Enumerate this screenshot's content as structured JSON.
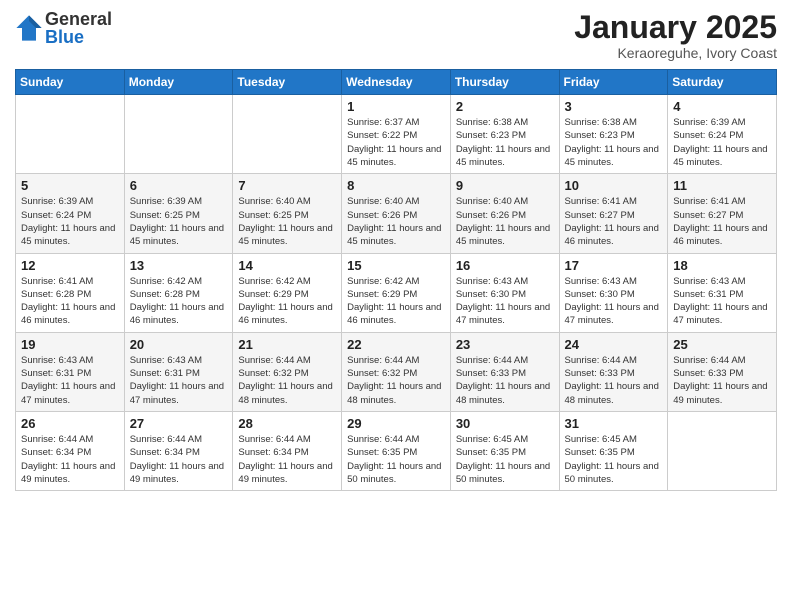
{
  "logo": {
    "general": "General",
    "blue": "Blue"
  },
  "title": "January 2025",
  "subtitle": "Keraoreguhe, Ivory Coast",
  "weekdays": [
    "Sunday",
    "Monday",
    "Tuesday",
    "Wednesday",
    "Thursday",
    "Friday",
    "Saturday"
  ],
  "weeks": [
    [
      {
        "day": "",
        "info": ""
      },
      {
        "day": "",
        "info": ""
      },
      {
        "day": "",
        "info": ""
      },
      {
        "day": "1",
        "info": "Sunrise: 6:37 AM\nSunset: 6:22 PM\nDaylight: 11 hours and 45 minutes."
      },
      {
        "day": "2",
        "info": "Sunrise: 6:38 AM\nSunset: 6:23 PM\nDaylight: 11 hours and 45 minutes."
      },
      {
        "day": "3",
        "info": "Sunrise: 6:38 AM\nSunset: 6:23 PM\nDaylight: 11 hours and 45 minutes."
      },
      {
        "day": "4",
        "info": "Sunrise: 6:39 AM\nSunset: 6:24 PM\nDaylight: 11 hours and 45 minutes."
      }
    ],
    [
      {
        "day": "5",
        "info": "Sunrise: 6:39 AM\nSunset: 6:24 PM\nDaylight: 11 hours and 45 minutes."
      },
      {
        "day": "6",
        "info": "Sunrise: 6:39 AM\nSunset: 6:25 PM\nDaylight: 11 hours and 45 minutes."
      },
      {
        "day": "7",
        "info": "Sunrise: 6:40 AM\nSunset: 6:25 PM\nDaylight: 11 hours and 45 minutes."
      },
      {
        "day": "8",
        "info": "Sunrise: 6:40 AM\nSunset: 6:26 PM\nDaylight: 11 hours and 45 minutes."
      },
      {
        "day": "9",
        "info": "Sunrise: 6:40 AM\nSunset: 6:26 PM\nDaylight: 11 hours and 45 minutes."
      },
      {
        "day": "10",
        "info": "Sunrise: 6:41 AM\nSunset: 6:27 PM\nDaylight: 11 hours and 46 minutes."
      },
      {
        "day": "11",
        "info": "Sunrise: 6:41 AM\nSunset: 6:27 PM\nDaylight: 11 hours and 46 minutes."
      }
    ],
    [
      {
        "day": "12",
        "info": "Sunrise: 6:41 AM\nSunset: 6:28 PM\nDaylight: 11 hours and 46 minutes."
      },
      {
        "day": "13",
        "info": "Sunrise: 6:42 AM\nSunset: 6:28 PM\nDaylight: 11 hours and 46 minutes."
      },
      {
        "day": "14",
        "info": "Sunrise: 6:42 AM\nSunset: 6:29 PM\nDaylight: 11 hours and 46 minutes."
      },
      {
        "day": "15",
        "info": "Sunrise: 6:42 AM\nSunset: 6:29 PM\nDaylight: 11 hours and 46 minutes."
      },
      {
        "day": "16",
        "info": "Sunrise: 6:43 AM\nSunset: 6:30 PM\nDaylight: 11 hours and 47 minutes."
      },
      {
        "day": "17",
        "info": "Sunrise: 6:43 AM\nSunset: 6:30 PM\nDaylight: 11 hours and 47 minutes."
      },
      {
        "day": "18",
        "info": "Sunrise: 6:43 AM\nSunset: 6:31 PM\nDaylight: 11 hours and 47 minutes."
      }
    ],
    [
      {
        "day": "19",
        "info": "Sunrise: 6:43 AM\nSunset: 6:31 PM\nDaylight: 11 hours and 47 minutes."
      },
      {
        "day": "20",
        "info": "Sunrise: 6:43 AM\nSunset: 6:31 PM\nDaylight: 11 hours and 47 minutes."
      },
      {
        "day": "21",
        "info": "Sunrise: 6:44 AM\nSunset: 6:32 PM\nDaylight: 11 hours and 48 minutes."
      },
      {
        "day": "22",
        "info": "Sunrise: 6:44 AM\nSunset: 6:32 PM\nDaylight: 11 hours and 48 minutes."
      },
      {
        "day": "23",
        "info": "Sunrise: 6:44 AM\nSunset: 6:33 PM\nDaylight: 11 hours and 48 minutes."
      },
      {
        "day": "24",
        "info": "Sunrise: 6:44 AM\nSunset: 6:33 PM\nDaylight: 11 hours and 48 minutes."
      },
      {
        "day": "25",
        "info": "Sunrise: 6:44 AM\nSunset: 6:33 PM\nDaylight: 11 hours and 49 minutes."
      }
    ],
    [
      {
        "day": "26",
        "info": "Sunrise: 6:44 AM\nSunset: 6:34 PM\nDaylight: 11 hours and 49 minutes."
      },
      {
        "day": "27",
        "info": "Sunrise: 6:44 AM\nSunset: 6:34 PM\nDaylight: 11 hours and 49 minutes."
      },
      {
        "day": "28",
        "info": "Sunrise: 6:44 AM\nSunset: 6:34 PM\nDaylight: 11 hours and 49 minutes."
      },
      {
        "day": "29",
        "info": "Sunrise: 6:44 AM\nSunset: 6:35 PM\nDaylight: 11 hours and 50 minutes."
      },
      {
        "day": "30",
        "info": "Sunrise: 6:45 AM\nSunset: 6:35 PM\nDaylight: 11 hours and 50 minutes."
      },
      {
        "day": "31",
        "info": "Sunrise: 6:45 AM\nSunset: 6:35 PM\nDaylight: 11 hours and 50 minutes."
      },
      {
        "day": "",
        "info": ""
      }
    ]
  ],
  "accent_color": "#2176c7"
}
